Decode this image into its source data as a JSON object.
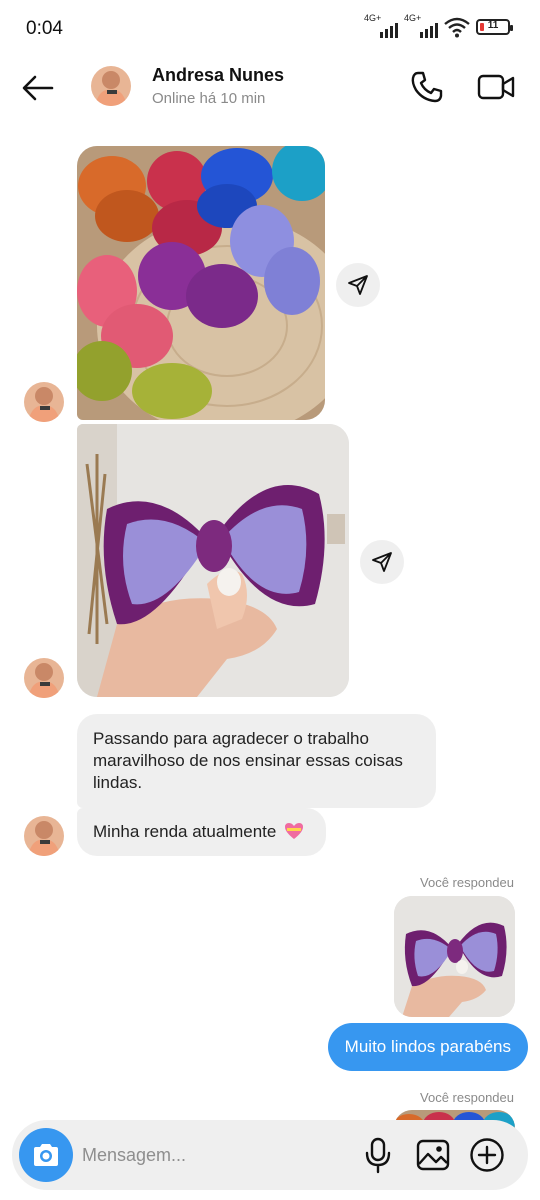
{
  "status_bar": {
    "time": "0:04",
    "network_1": "4G+",
    "network_2": "4G+",
    "battery": "11"
  },
  "header": {
    "name": "Andresa Nunes",
    "status": "Online há 10 min"
  },
  "messages": {
    "incoming_1": "Passando para agradecer o trabalho maravilhoso de nos ensinar essas coisas lindas.",
    "incoming_2": "Minha renda atualmente",
    "reply_meta_1": "Você respondeu",
    "outgoing_1": "Muito lindos parabéns",
    "reply_meta_2": "Você respondeu"
  },
  "composer": {
    "placeholder": "Mensagem..."
  },
  "icons": {
    "back": "arrow-left-icon",
    "call": "phone-icon",
    "video": "video-camera-icon",
    "share": "paper-plane-icon",
    "camera": "camera-icon",
    "mic": "microphone-icon",
    "gallery": "image-icon",
    "plus": "plus-circle-icon"
  },
  "colors": {
    "accent": "#3797f0",
    "incoming_bubble": "#efefef",
    "secondary_text": "#8a8a8a"
  }
}
